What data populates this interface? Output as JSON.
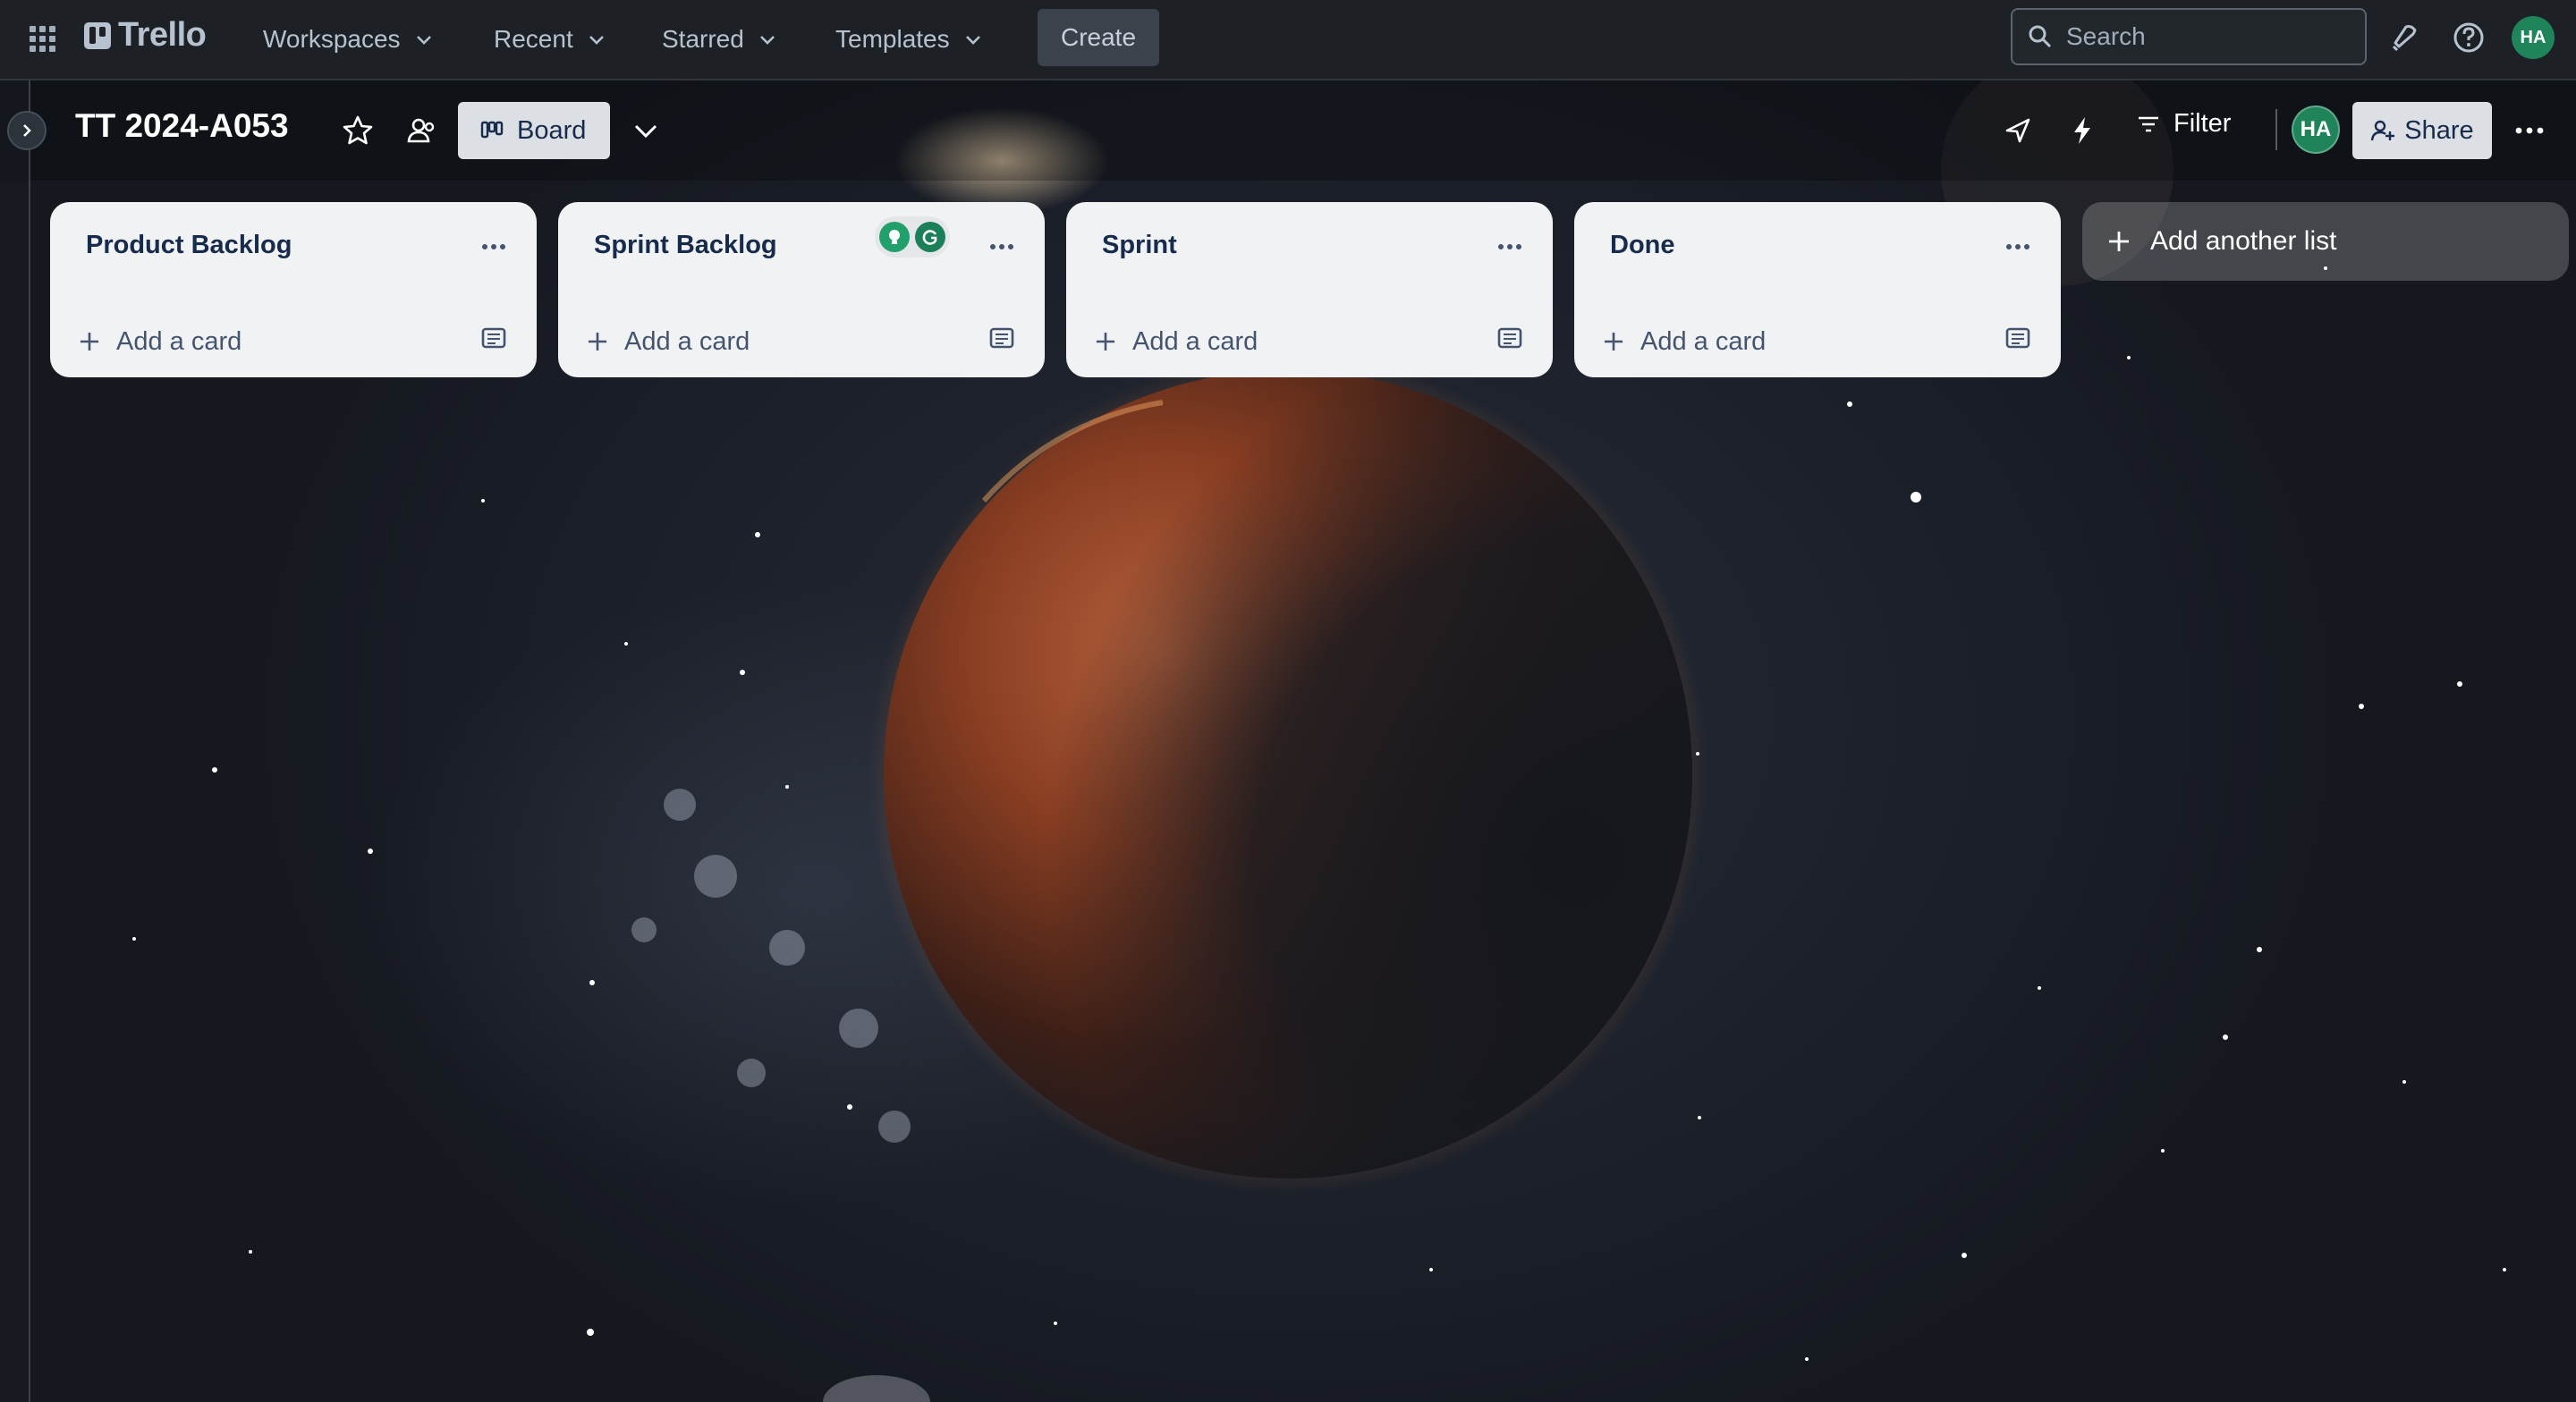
{
  "topbar": {
    "apps_icon": "grid-icon",
    "logo_text": "Trello",
    "nav": [
      {
        "label": "Workspaces"
      },
      {
        "label": "Recent"
      },
      {
        "label": "Starred"
      },
      {
        "label": "Templates"
      }
    ],
    "create_label": "Create",
    "search_placeholder": "Search",
    "user_initials": "HA"
  },
  "board": {
    "title": "TT 2024-A053",
    "view_label": "Board",
    "filter_label": "Filter",
    "share_label": "Share",
    "member_initials": "HA"
  },
  "lists": [
    {
      "title": "Product Backlog",
      "add_card_label": "Add a card"
    },
    {
      "title": "Sprint Backlog",
      "add_card_label": "Add a card"
    },
    {
      "title": "Sprint",
      "add_card_label": "Add a card"
    },
    {
      "title": "Done",
      "add_card_label": "Add a card"
    }
  ],
  "add_list_label": "Add another list",
  "colors": {
    "topbar_bg": "#1d2125",
    "list_bg": "#f1f2f4",
    "avatar_green": "#1f845a",
    "text_dark": "#172b4d"
  }
}
